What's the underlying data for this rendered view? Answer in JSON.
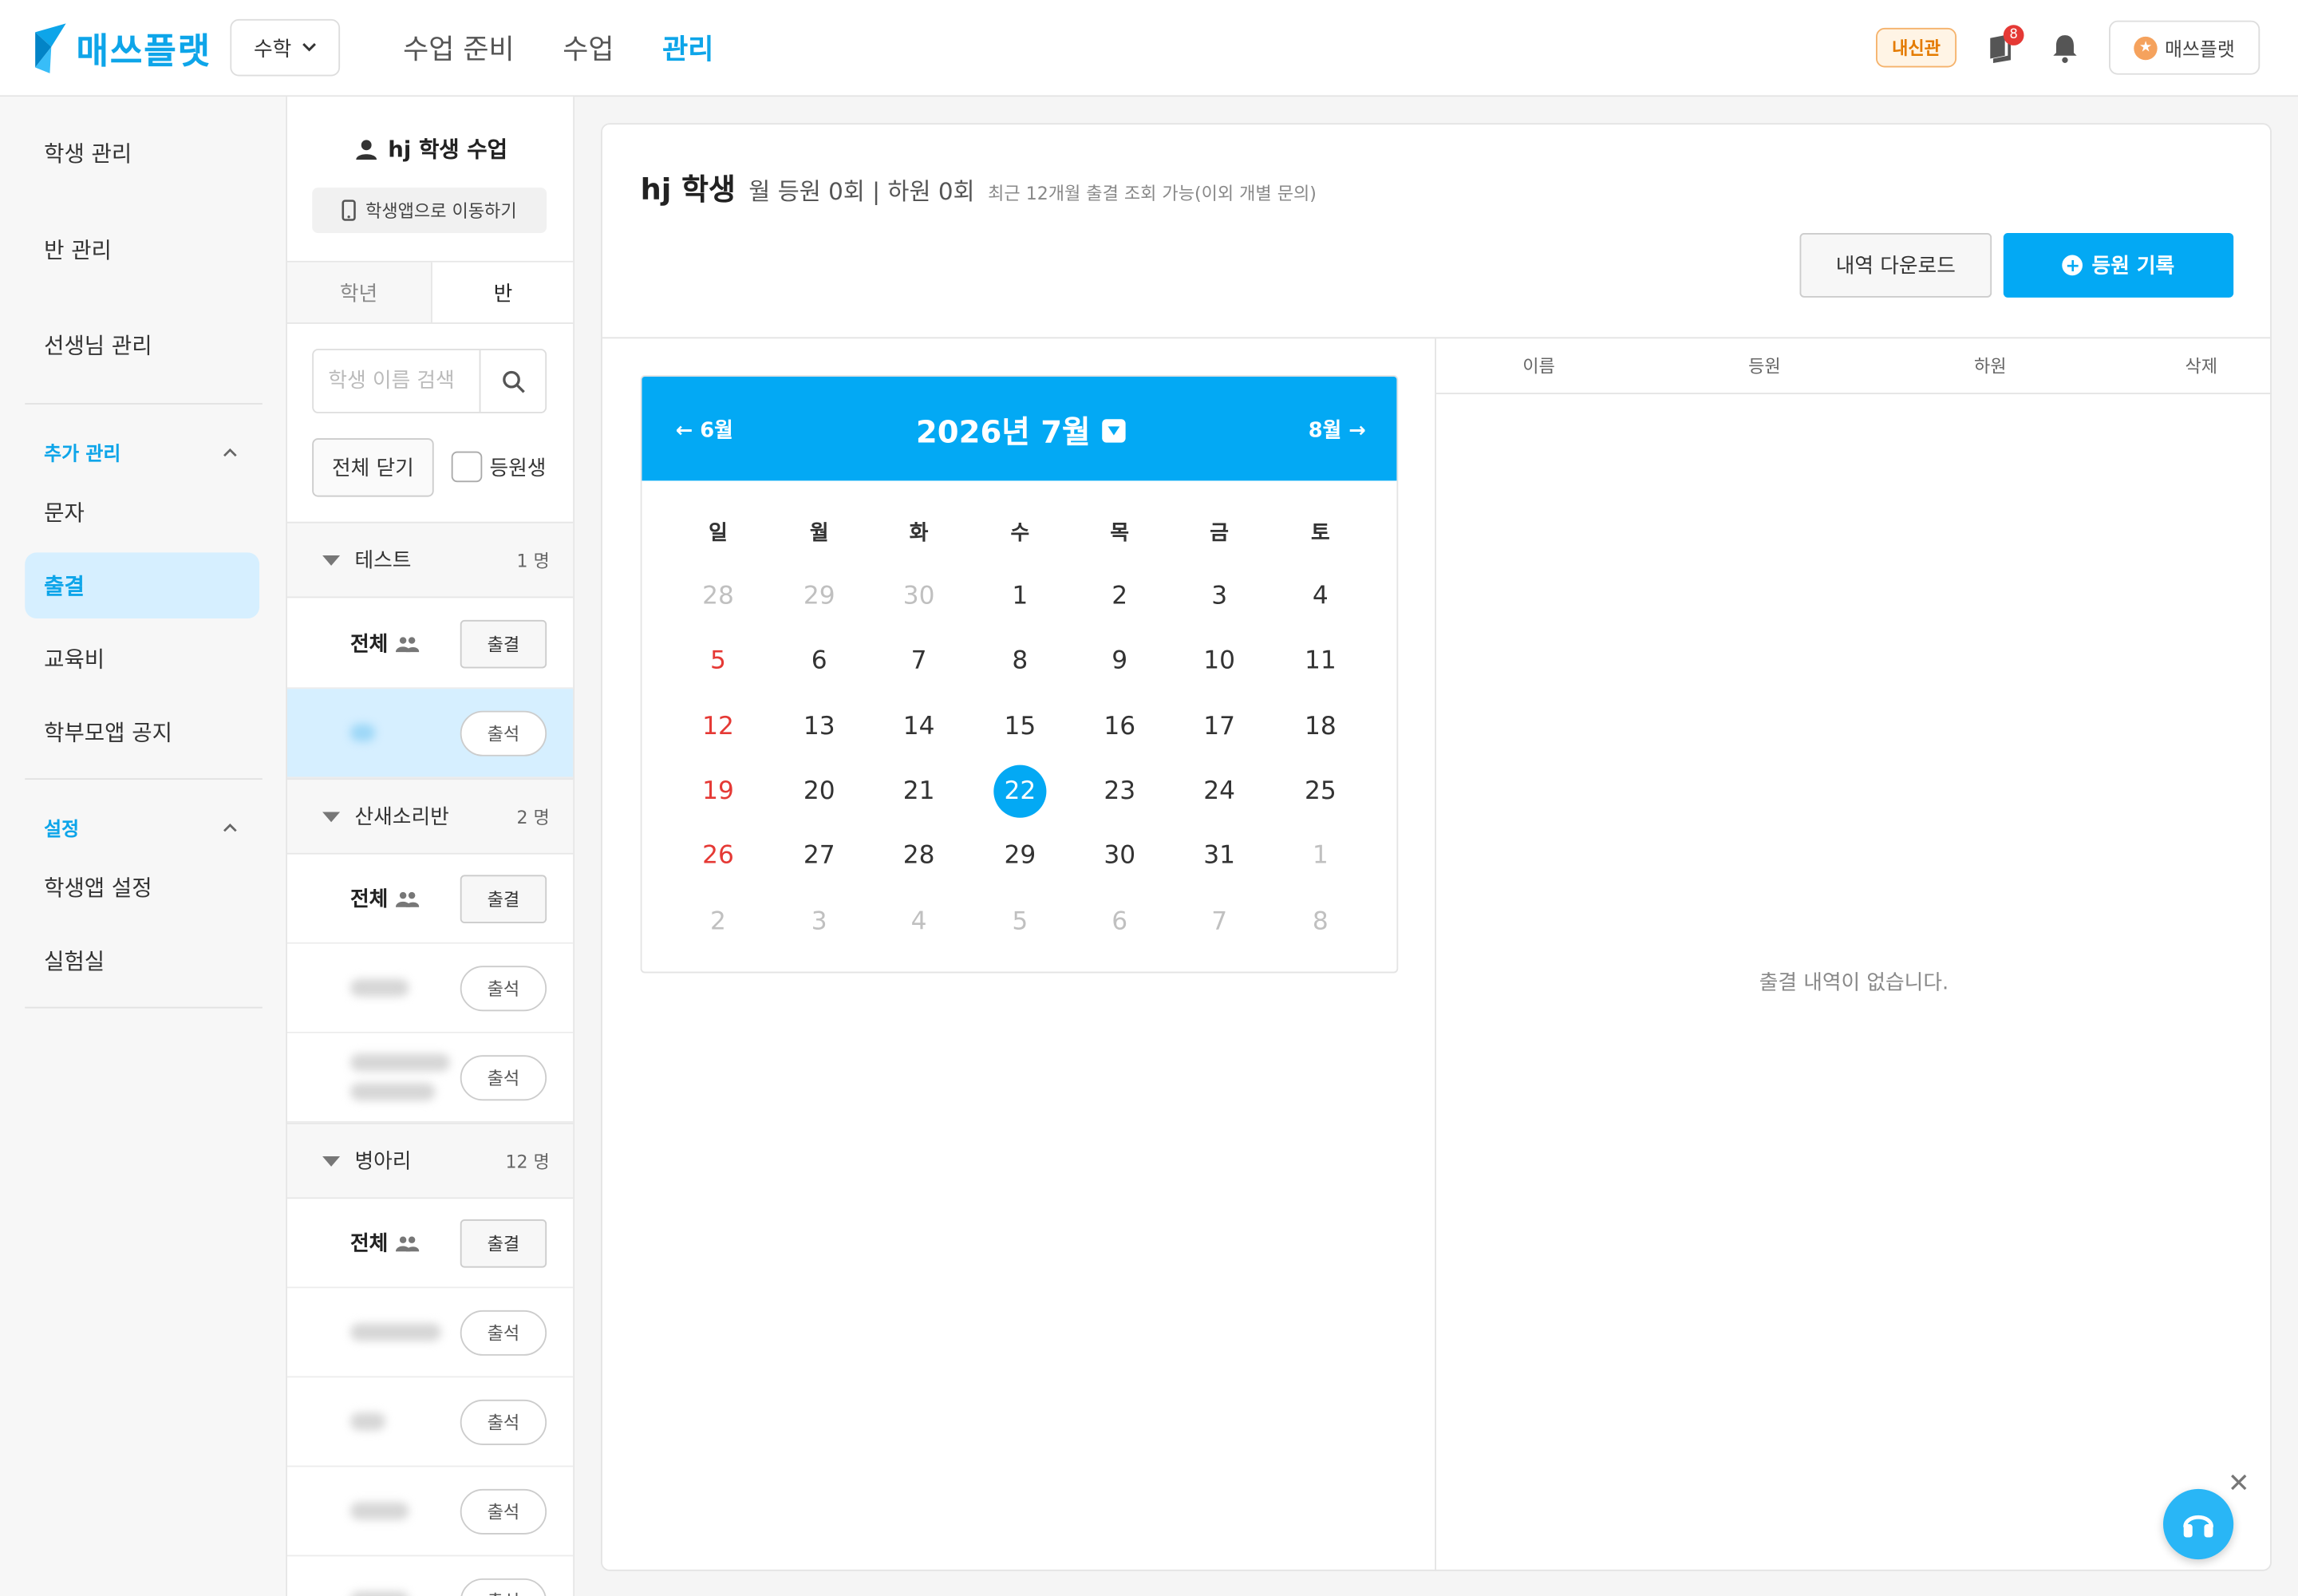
{
  "brand": {
    "logo_text": "매쓰플랫",
    "accent": "#0ea5e9"
  },
  "header": {
    "subject": "수학",
    "nav": [
      {
        "label": "수업 준비",
        "active": false
      },
      {
        "label": "수업",
        "active": false
      },
      {
        "label": "관리",
        "active": true
      }
    ],
    "badge": "내신관",
    "notification_count": "8",
    "profile_name": "매쓰플랫",
    "profile_icon": "star-icon"
  },
  "sidebar": {
    "items_top": [
      "학생 관리",
      "반 관리",
      "선생님 관리"
    ],
    "section_extra": {
      "title": "추가 관리",
      "items": [
        "문자",
        "출결",
        "교육비",
        "학부모앱 공지"
      ],
      "active": "출결"
    },
    "section_settings": {
      "title": "설정",
      "items": [
        "학생앱 설정",
        "실험실"
      ]
    }
  },
  "students": {
    "title": "hj 학생 수업",
    "app_button": "학생앱으로 이동하기",
    "tabs": [
      "학년",
      "반"
    ],
    "active_tab": "반",
    "search_placeholder": "학생 이름 검색",
    "close_all": "전체 닫기",
    "checkbox_label": "등원생",
    "all_label": "전체",
    "attendance_btn": "출결",
    "present_btn": "출석",
    "groups": [
      {
        "name": "테스트",
        "count": "1 명"
      },
      {
        "name": "산새소리반",
        "count": "2 명"
      },
      {
        "name": "병아리",
        "count": "12 명"
      }
    ]
  },
  "main": {
    "student_name": "hj 학생",
    "stats": "월 등원 0회 | 하원 0회",
    "note": "최근 12개월 출결 조회 가능(이외 개별 문의)",
    "download_btn": "내역 다운로드",
    "record_btn": "등원 기록",
    "table_headers": [
      "이름",
      "등원",
      "하원",
      "삭제"
    ],
    "empty_text": "출결 내역이 없습니다."
  },
  "calendar": {
    "title": "2026년 7월",
    "prev": "← 6월",
    "next": "8월 →",
    "weekdays": [
      "일",
      "월",
      "화",
      "수",
      "목",
      "금",
      "토"
    ],
    "today": 22,
    "days": [
      [
        "28",
        "29",
        "30",
        "1",
        "2",
        "3",
        "4"
      ],
      [
        "5",
        "6",
        "7",
        "8",
        "9",
        "10",
        "11"
      ],
      [
        "12",
        "13",
        "14",
        "15",
        "16",
        "17",
        "18"
      ],
      [
        "19",
        "20",
        "21",
        "22",
        "23",
        "24",
        "25"
      ],
      [
        "26",
        "27",
        "28",
        "29",
        "30",
        "31",
        "1"
      ],
      [
        "2",
        "3",
        "4",
        "5",
        "6",
        "7",
        "8"
      ]
    ]
  },
  "colors": {
    "primary": "#03a9f4",
    "sunday": "#e53935",
    "selected_row": "#d6efff"
  }
}
